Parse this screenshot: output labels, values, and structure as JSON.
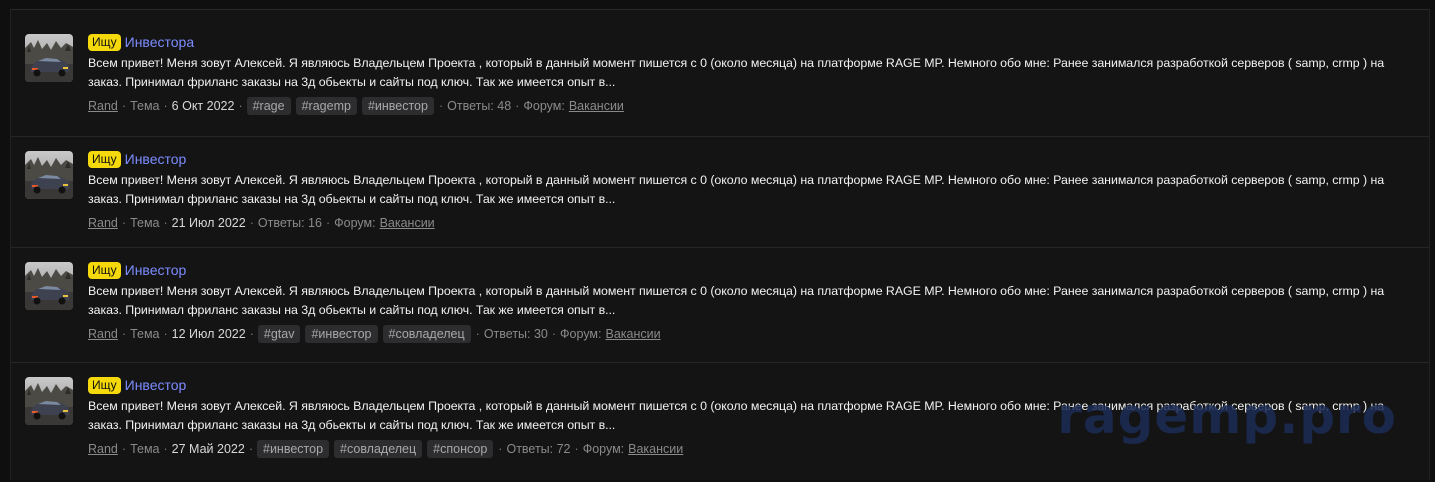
{
  "watermark": "ragemp.pro",
  "results": [
    {
      "prefix": "Ищу",
      "title": "Инвестора",
      "snippet": "Всем привет! Меня зовут Алексей. Я являюсь Владельцем Проекта , который в данный момент пишется с 0 (около месяца) на платформе RAGE MP. Немного обо мне: Ранее занимался разработкой серверов ( samp, crmp ) на заказ. Принимал фриланс заказы на 3д обьекты и сайты под ключ. Так же имеется опыт в...",
      "author": "Rand",
      "type": "Тема",
      "date": "6 Окт 2022",
      "tags": [
        "#rage",
        "#ragemp",
        "#инвестор"
      ],
      "replies": "Ответы: 48",
      "forum_label": "Форум:",
      "forum": "Вакансии"
    },
    {
      "prefix": "Ищу",
      "title": "Инвестор",
      "snippet": "Всем привет! Меня зовут Алексей. Я являюсь Владельцем Проекта , который в данный момент пишется с 0 (около месяца) на платформе RAGE MP. Немного обо мне: Ранее занимался разработкой серверов ( samp, crmp ) на заказ. Принимал фриланс заказы на 3д обьекты и сайты под ключ. Так же имеется опыт в...",
      "author": "Rand",
      "type": "Тема",
      "date": "21 Июл 2022",
      "tags": [],
      "replies": "Ответы: 16",
      "forum_label": "Форум:",
      "forum": "Вакансии"
    },
    {
      "prefix": "Ищу",
      "title": "Инвестор",
      "snippet": "Всем привет! Меня зовут Алексей. Я являюсь Владельцем Проекта , который в данный момент пишется с 0 (около месяца) на платформе RAGE MP. Немного обо мне: Ранее занимался разработкой серверов ( samp, crmp ) на заказ. Принимал фриланс заказы на 3д обьекты и сайты под ключ. Так же имеется опыт в...",
      "author": "Rand",
      "type": "Тема",
      "date": "12 Июл 2022",
      "tags": [
        "#gtav",
        "#инвестор",
        "#совладелец"
      ],
      "replies": "Ответы: 30",
      "forum_label": "Форум:",
      "forum": "Вакансии"
    },
    {
      "prefix": "Ищу",
      "title": "Инвестор",
      "snippet": "Всем привет! Меня зовут Алексей. Я являюсь Владельцем Проекта , который в данный момент пишется с 0 (около месяца) на платформе RAGE MP. Немного обо мне: Ранее занимался разработкой серверов ( samp, crmp ) на заказ. Принимал фриланс заказы на 3д обьекты и сайты под ключ. Так же имеется опыт в...",
      "author": "Rand",
      "type": "Тема",
      "date": "27 Май 2022",
      "tags": [
        "#инвестор",
        "#совладелец",
        "#спонсор"
      ],
      "replies": "Ответы: 72",
      "forum_label": "Форум:",
      "forum": "Вакансии"
    }
  ]
}
